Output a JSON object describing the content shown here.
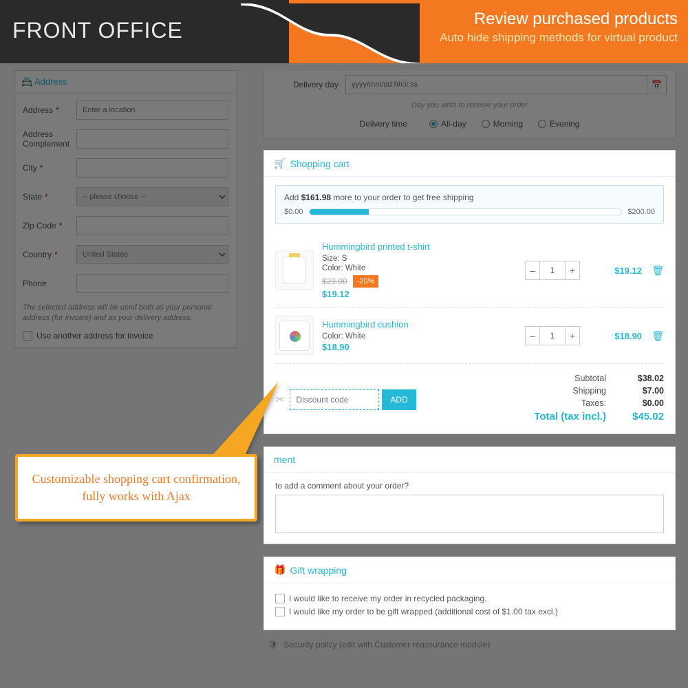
{
  "banner": {
    "left": "FRONT OFFICE",
    "right_title": "Review purchased products",
    "right_sub": "Auto hide shipping methods for virtual product"
  },
  "address": {
    "header": "Address",
    "fields": {
      "address": "Address",
      "address_ph": "Enter a location",
      "complement": "Address Complement",
      "city": "City",
      "state": "State",
      "state_ph": "-- please choose --",
      "zip": "Zip Code",
      "country": "Country",
      "country_val": "United States",
      "phone": "Phone"
    },
    "note": "The selected address will be used both as your personal address (for invoice) and as your delivery address.",
    "chk": "Use another address for invoice"
  },
  "delivery": {
    "day_label": "Delivery day",
    "day_ph": "yyyy/mm/dd hh:ii:ss",
    "hint": "Day you wish to receive your order",
    "time_label": "Delivery time",
    "opts": [
      "All-day",
      "Morning",
      "Evening"
    ]
  },
  "cart": {
    "header": "Shopping cart",
    "free_ship_prefix": "Add ",
    "free_ship_amount": "$161.98",
    "free_ship_suffix": " more to your order to get free shipping",
    "progress_min": "$0.00",
    "progress_max": "$200.00",
    "progress_pct": 19,
    "items": [
      {
        "name": "Hummingbird printed t-shirt",
        "attrs": [
          "Size: S",
          "Color: White"
        ],
        "old_price": "$23.90",
        "discount": "-20%",
        "price": "$19.12",
        "qty": "1",
        "line_total": "$19.12"
      },
      {
        "name": "Hummingbird cushion",
        "attrs": [
          "Color: White"
        ],
        "price": "$18.90",
        "qty": "1",
        "line_total": "$18.90"
      }
    ],
    "discount_ph": "Discount code",
    "add_btn": "ADD",
    "totals": {
      "subtotal_l": "Subtotal",
      "subtotal_v": "$38.02",
      "shipping_l": "Shipping",
      "shipping_v": "$7.00",
      "taxes_l": "Taxes:",
      "taxes_v": "$0.00",
      "total_l": "Total (tax incl.)",
      "total_v": "$45.02"
    }
  },
  "comment": {
    "header_suffix": "ment",
    "label": "to add a comment about your order?"
  },
  "gift": {
    "header": "Gift wrapping",
    "opt1": "I would like to receive my order in recycled packaging.",
    "opt2": "I would like my order to be gift wrapped (additional cost of $1.00 tax excl.)"
  },
  "security": "Security policy (edit with Customer reassurance module)",
  "callout": "Customizable shopping cart confirmation, fully works with Ajax"
}
